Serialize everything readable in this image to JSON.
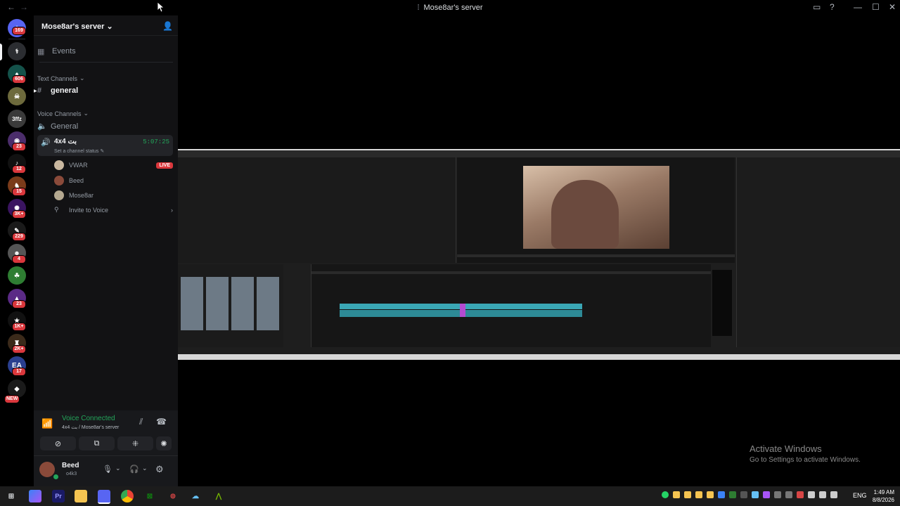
{
  "window": {
    "title": "Mose8ar's server",
    "back_icon": "arrow-left-icon",
    "forward_icon": "arrow-right-icon",
    "inbox_icon": "inbox-icon",
    "help_icon": "help-icon",
    "minimize": "—",
    "maximize": "☐",
    "close": "✕"
  },
  "guilds": {
    "home_badge": "169",
    "badges": [
      "606",
      "23",
      "12",
      "15",
      "3K+",
      "229",
      "4",
      "23",
      "1K+",
      "2K+",
      "17"
    ],
    "new_label": "NEW",
    "letters": [
      "3ffz",
      "EA"
    ]
  },
  "sidebar": {
    "server_name": "Mose8ar's server",
    "events_label": "Events",
    "text_category": "Text Channels",
    "text_channels": [
      {
        "name": "general"
      }
    ],
    "voice_category": "Voice Channels",
    "voice_channels": [
      {
        "name": "General"
      },
      {
        "name": "4x4 بت",
        "timer": "5:07:25",
        "status_placeholder": "Set a channel status"
      }
    ],
    "voice_users": [
      {
        "name": "VWAR",
        "live": "LIVE"
      },
      {
        "name": "Beed"
      },
      {
        "name": "Mose8ar"
      }
    ],
    "invite_label": "Invite to Voice"
  },
  "voice_panel": {
    "status": "Voice Connected",
    "channel_path": "4x4 بت / Mose8ar's server",
    "user_name": "Beed",
    "user_status": "o4k3"
  },
  "stage": {
    "watermark_title": "Activate Windows",
    "watermark_sub": "Go to Settings to activate Windows."
  },
  "taskbar": {
    "lang": "ENG",
    "time": "1:49 AM",
    "date": "8/8/2026",
    "apps": [
      "windows-start-icon",
      "copilot-icon",
      "premiere-icon",
      "file-explorer-icon",
      "discord-icon",
      "chrome-icon",
      "xbox-icon",
      "steam-alt-icon",
      "steam-icon",
      "nvidia-icon"
    ]
  },
  "colors": {
    "accent_green": "#23a55a",
    "live_red": "#da373c",
    "timeline_clip": "#3aa7b5",
    "clip_purple": "#b44bd1"
  }
}
